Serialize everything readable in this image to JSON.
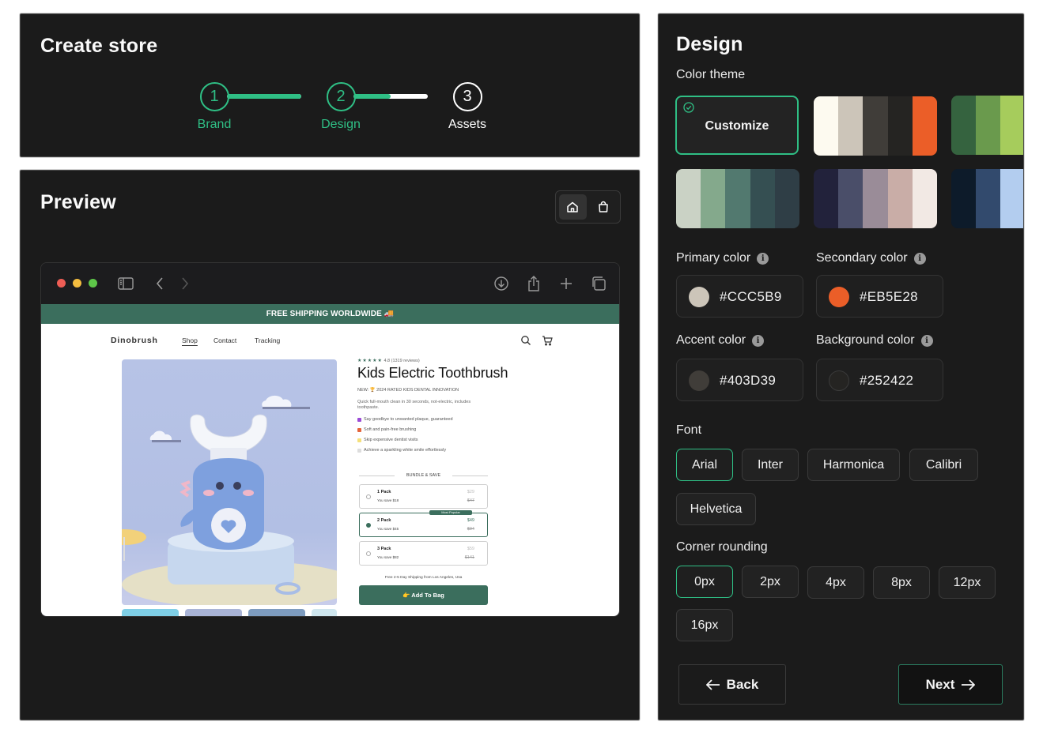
{
  "create_store": {
    "title": "Create store",
    "steps": [
      {
        "number": "1",
        "label": "Brand",
        "status": "complete"
      },
      {
        "number": "2",
        "label": "Design",
        "status": "current"
      },
      {
        "number": "3",
        "label": "Assets",
        "status": "pending"
      }
    ],
    "connector_progress": [
      1.0,
      0.5
    ],
    "accent_color": "#2FBF85"
  },
  "preview": {
    "title": "Preview",
    "view_toggle": [
      {
        "icon": "home-icon",
        "active": true
      },
      {
        "icon": "shopping-bag-icon",
        "active": false
      }
    ],
    "browser": {
      "toolbar_icons": [
        "sidebar-icon",
        "back-icon",
        "forward-icon",
        "download-icon",
        "share-icon",
        "new-tab-icon",
        "tabs-icon"
      ]
    },
    "site": {
      "announcement": "FREE SHIPPING WORLDWIDE 🚚",
      "brand": "Dinobrush",
      "nav": [
        "Shop",
        "Contact",
        "Tracking"
      ],
      "active_nav": "Shop",
      "rating_stars": "★★★★★",
      "rating_text": "4.8 (1319 reviews)",
      "product_title": "Kids Electric Toothbrush",
      "badge_line": "NEW: 🏆 2024 RATED KIDS DENTAL INNOVATION",
      "description": "Quick full-mouth clean in 30 seconds, not-electric, includes toothpaste.",
      "bullets": [
        "Say goodbye to unwanted plaque, guaranteed",
        "Soft and pain-free brushing",
        "Skip expensive dentist visits",
        "Achieve a sparkling white smile effortlessly"
      ],
      "bundle_title": "BUNDLE & SAVE",
      "packs": [
        {
          "name": "1 Pack",
          "savings": "You save $18",
          "price": "$29",
          "old_price": "$47",
          "selected": false
        },
        {
          "name": "2 Pack",
          "savings": "You save $45",
          "price": "$49",
          "old_price": "$94",
          "selected": true,
          "tag": "Most Popular"
        },
        {
          "name": "3 Pack",
          "savings": "You save $82",
          "price": "$59",
          "old_price": "$141",
          "selected": false
        }
      ],
      "shipping_note": "Free 2-5 Day Shipping from Los Angeles, Usa",
      "add_to_bag": "👉 Add To Bag",
      "brand_color": "#3B6E5D"
    }
  },
  "design": {
    "title": "Design",
    "color_theme_label": "Color theme",
    "customize_label": "Customize",
    "themes": [
      {
        "selected": true,
        "custom": true
      },
      {
        "colors": [
          "#FDFAF0",
          "#CCC5B9",
          "#403D39",
          "#252422",
          "#EB5E28"
        ]
      },
      {
        "colors": [
          "#35633F",
          "#6A9A4D",
          "#A6CC5C",
          "#C9E08A",
          "#EEF3D2"
        ]
      },
      {
        "colors": [
          "#CAD2C5",
          "#84A98C",
          "#52796F",
          "#354F52",
          "#2F3E46"
        ]
      },
      {
        "colors": [
          "#22223B",
          "#4A4E69",
          "#9A8C98",
          "#C9ADA7",
          "#F2E9E4"
        ]
      },
      {
        "colors": [
          "#0D1B2A",
          "#324A6D",
          "#B3CDEF",
          "#D9E4F5",
          "#F0F4FA"
        ]
      }
    ],
    "colors": [
      {
        "label": "Primary color",
        "value": "#CCC5B9"
      },
      {
        "label": "Secondary color",
        "value": "#EB5E28"
      },
      {
        "label": "Accent color",
        "value": "#403D39"
      },
      {
        "label": "Background color",
        "value": "#252422"
      }
    ],
    "font_label": "Font",
    "fonts": [
      "Arial",
      "Inter",
      "Harmonica",
      "Calibri",
      "Helvetica"
    ],
    "selected_font": "Arial",
    "corner_label": "Corner rounding",
    "corners": [
      "0px",
      "2px",
      "4px",
      "8px",
      "12px",
      "16px"
    ],
    "selected_corner": "0px",
    "back_label": "Back",
    "next_label": "Next"
  }
}
